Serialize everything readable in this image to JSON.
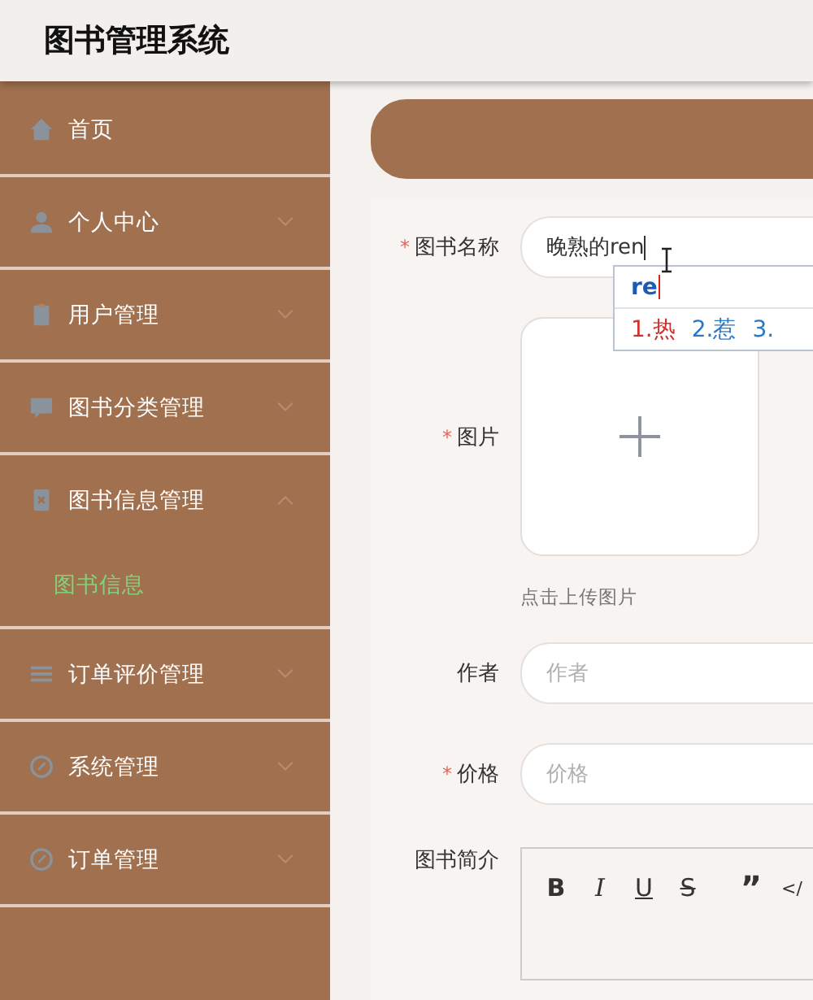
{
  "header": {
    "title": "图书管理系统"
  },
  "sidebar": {
    "items": [
      {
        "label": "首页",
        "kind": "link"
      },
      {
        "label": "个人中心",
        "kind": "group",
        "expanded": false
      },
      {
        "label": "用户管理",
        "kind": "group",
        "expanded": false
      },
      {
        "label": "图书分类管理",
        "kind": "group",
        "expanded": false
      },
      {
        "label": "图书信息管理",
        "kind": "group",
        "expanded": true,
        "children": [
          {
            "label": "图书信息",
            "selected": true
          }
        ]
      },
      {
        "label": "订单评价管理",
        "kind": "group",
        "expanded": false
      },
      {
        "label": "系统管理",
        "kind": "group",
        "expanded": false
      },
      {
        "label": "订单管理",
        "kind": "group",
        "expanded": false
      }
    ]
  },
  "form": {
    "fields": [
      {
        "label": "图书名称",
        "required_mark": "*",
        "kind": "text",
        "value": "晚熟的ren"
      },
      {
        "label": "图片",
        "required_mark": "*",
        "kind": "upload",
        "hint": "点击上传图片"
      },
      {
        "label": "作者",
        "kind": "text",
        "placeholder": "作者"
      },
      {
        "label": "价格",
        "required_mark": "*",
        "kind": "text",
        "placeholder": "价格"
      },
      {
        "label": "图书简介",
        "kind": "editor",
        "toolbar": [
          "B",
          "I",
          "U",
          "S",
          "”",
          "</"
        ]
      }
    ]
  },
  "ime": {
    "composition": "re",
    "candidates": [
      {
        "label": "1.热",
        "selected": true
      },
      {
        "label": "2.惹",
        "selected": false
      },
      {
        "label": "3.",
        "selected": false
      }
    ]
  }
}
